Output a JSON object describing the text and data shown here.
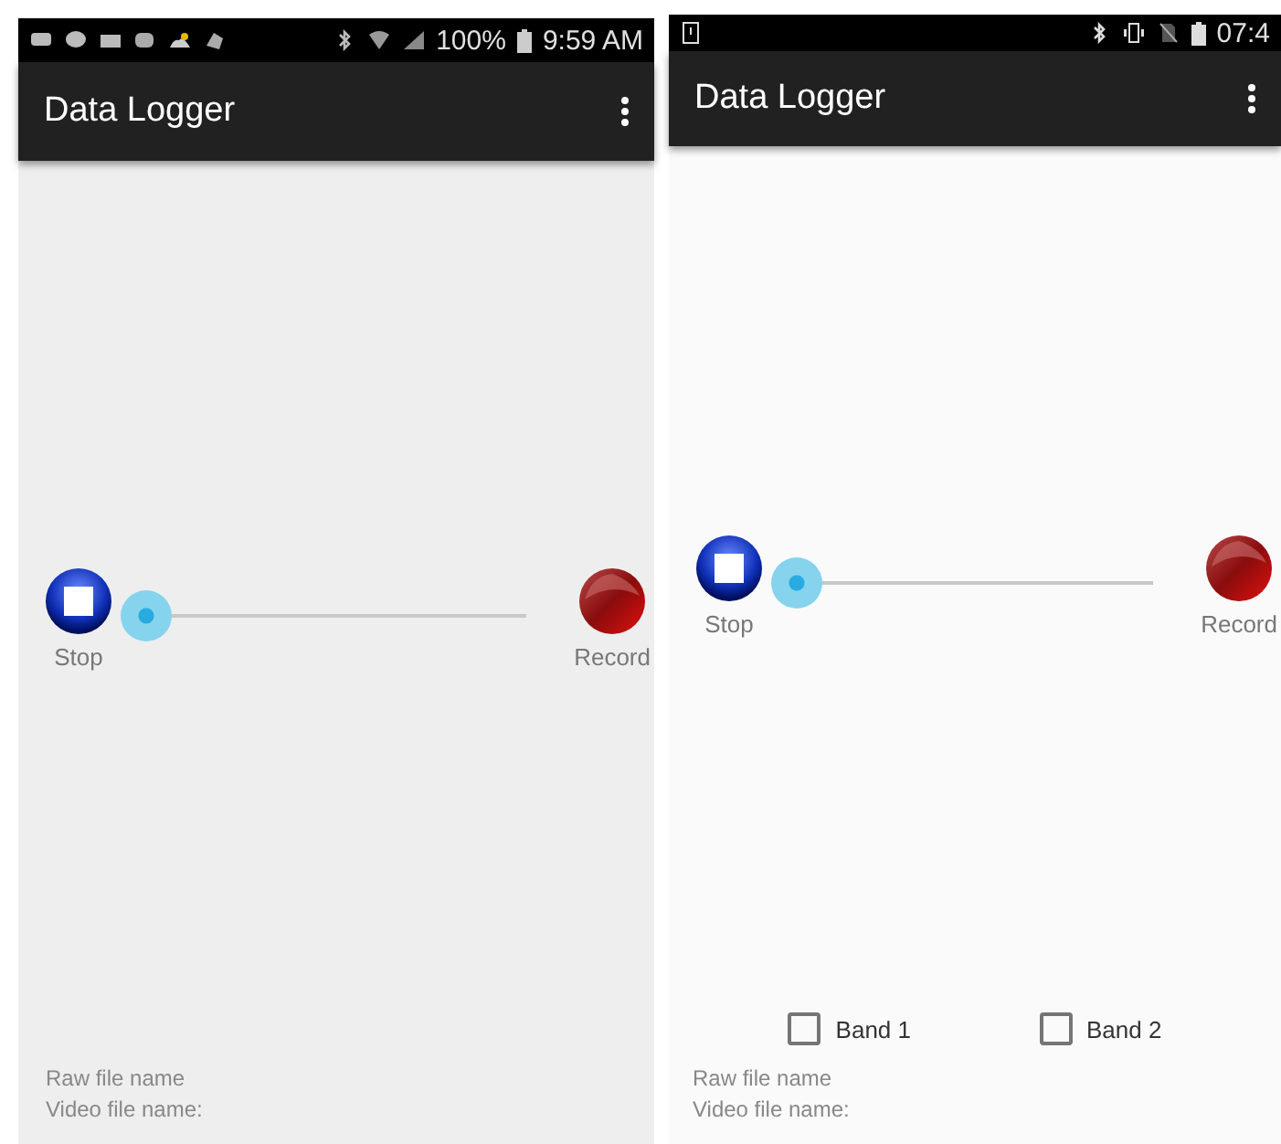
{
  "phones": [
    {
      "status_bar": {
        "kind": "notifications",
        "battery": "100%",
        "time": "9:59 AM"
      },
      "title": "Data Logger",
      "stop_label": "Stop",
      "record_label": "Record",
      "slider": {
        "level": 0
      },
      "raw_file": "Raw file name",
      "video_file": "Video file name:"
    },
    {
      "status_bar": {
        "kind": "plain",
        "time": "07:4"
      },
      "title": "Data Logger",
      "stop_label": "Stop",
      "record_label": "Record",
      "slider": {
        "level": 0
      },
      "checkboxes": [
        {
          "label": "Band 1",
          "checked": false
        },
        {
          "label": "Band 2",
          "checked": false
        }
      ],
      "raw_file": "Raw file name",
      "video_file": "Video file name:"
    }
  ]
}
